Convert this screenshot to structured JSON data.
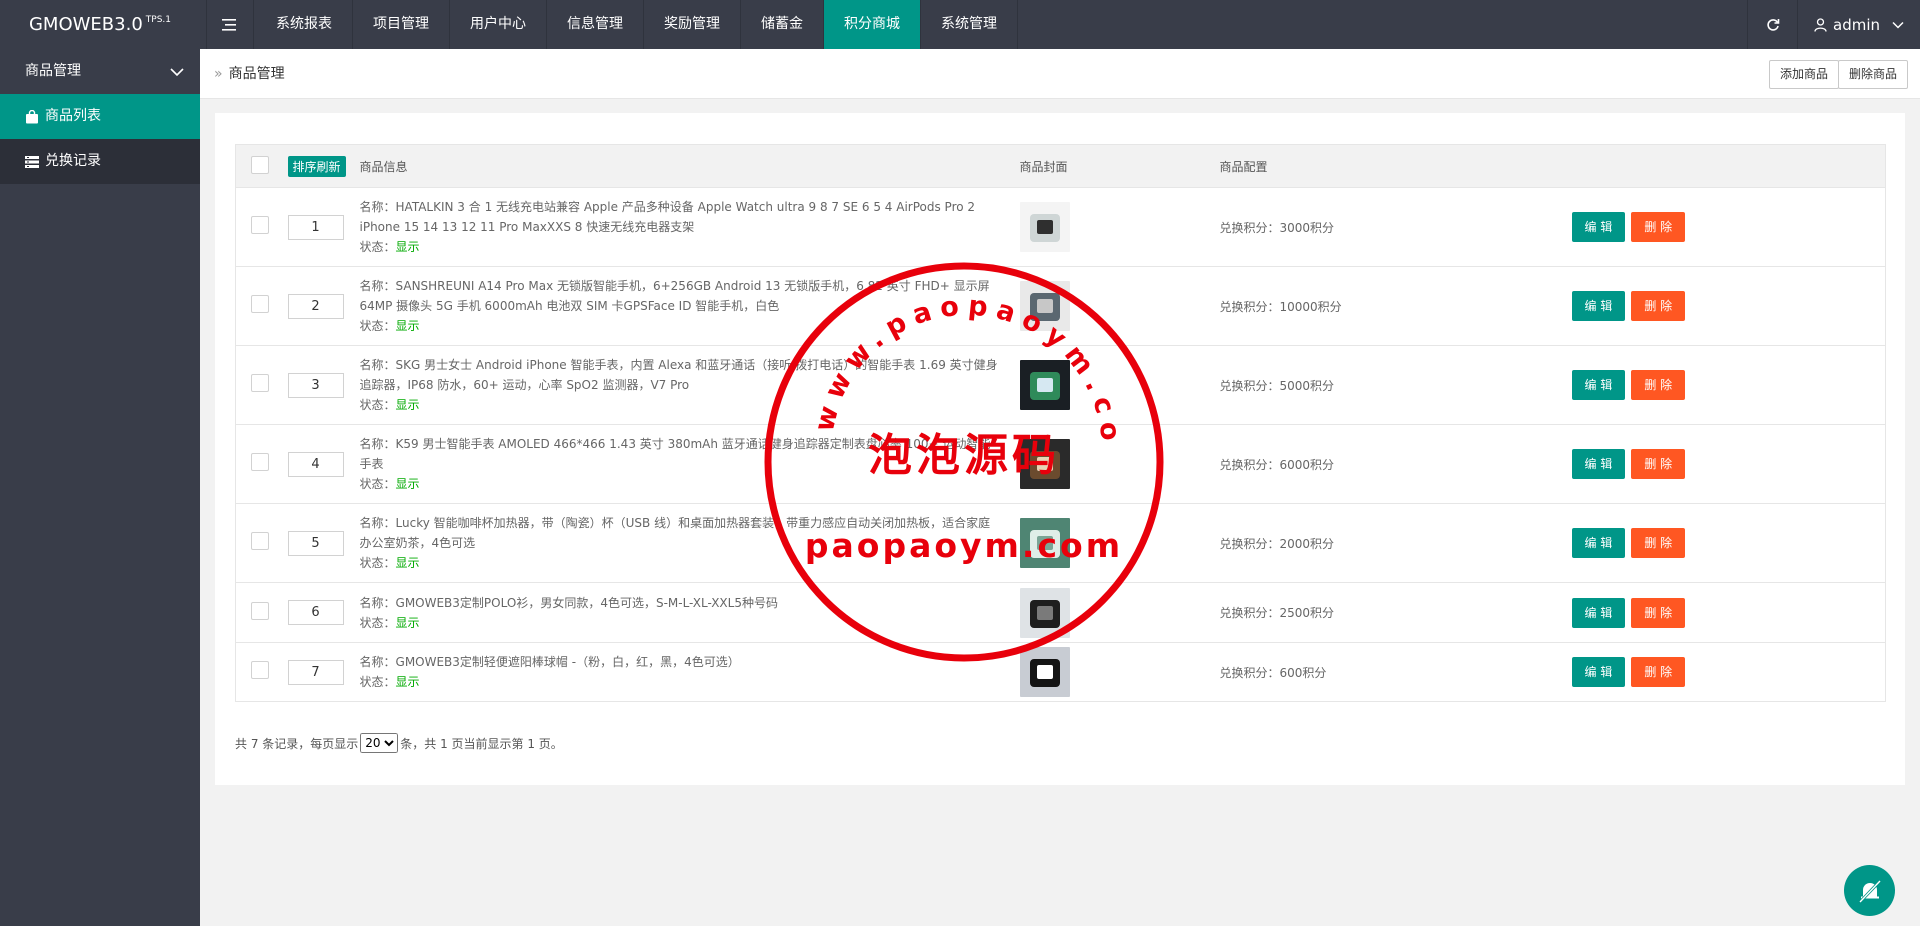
{
  "app": {
    "brand": "GMOWEB3.0",
    "brand_sup": "TPS.1"
  },
  "nav": [
    {
      "label": "系统报表",
      "active": false
    },
    {
      "label": "项目管理",
      "active": false
    },
    {
      "label": "用户中心",
      "active": false
    },
    {
      "label": "信息管理",
      "active": false
    },
    {
      "label": "奖励管理",
      "active": false
    },
    {
      "label": "储蓄金",
      "active": false
    },
    {
      "label": "积分商城",
      "active": true
    },
    {
      "label": "系统管理",
      "active": false
    }
  ],
  "user": {
    "name": "admin"
  },
  "sidebar": {
    "group": "商品管理",
    "items": [
      {
        "label": "商品列表",
        "active": true
      },
      {
        "label": "兑换记录",
        "active": false
      }
    ]
  },
  "breadcrumb": "商品管理",
  "toolbar": {
    "add": "添加商品",
    "delete": "删除商品"
  },
  "table": {
    "headers": {
      "sort": "排序刷新",
      "info": "商品信息",
      "cover": "商品封面",
      "config": "商品配置"
    },
    "name_prefix": "名称：",
    "status_prefix": "状态：",
    "edit_label": "编 辑",
    "delete_label": "删 除",
    "rows": [
      {
        "order": "1",
        "name": "HATALKIN 3 合 1 无线充电站兼容 Apple 产品多种设备 Apple Watch ultra 9 8 7 SE 6 5 4 AirPods Pro 2 iPhone 15 14 13 12 11 Pro MaxXXS 8 快速无线充电器支架",
        "status": "显示",
        "config": "兑换积分：3000积分"
      },
      {
        "order": "2",
        "name": "SANSHREUNI A14 Pro Max 无锁版智能手机，6+256GB Android 13 无锁版手机，6.82 英寸 FHD+ 显示屏 64MP 摄像头 5G 手机 6000mAh 电池双 SIM 卡GPSFace ID 智能手机，白色",
        "status": "显示",
        "config": "兑换积分：10000积分"
      },
      {
        "order": "3",
        "name": "SKG 男士女士 Android iPhone 智能手表，内置 Alexa 和蓝牙通话（接听/拨打电话）的智能手表 1.69 英寸健身追踪器，IP68 防水，60+ 运动，心率 SpO2 监测器，V7 Pro",
        "status": "显示",
        "config": "兑换积分：5000积分"
      },
      {
        "order": "4",
        "name": "K59 男士智能手表 AMOLED 466*466 1.43 英寸 380mAh 蓝牙通话健身追踪器定制表盘心率 100+ 运动智能手表",
        "status": "显示",
        "config": "兑换积分：6000积分"
      },
      {
        "order": "5",
        "name": "Lucky 智能咖啡杯加热器，带（陶瓷）杯（USB 线）和桌面加热器套装，带重力感应自动关闭加热板，适合家庭办公室奶茶，4色可选",
        "status": "显示",
        "config": "兑换积分：2000积分"
      },
      {
        "order": "6",
        "name": "GMOWEB3定制POLO衫，男女同款，4色可选，S-M-L-XL-XXL5种号码",
        "status": "显示",
        "config": "兑换积分：2500积分"
      },
      {
        "order": "7",
        "name": "GMOWEB3定制轻便遮阳棒球帽 -（粉，白，红，黑，4色可选）",
        "status": "显示",
        "config": "兑换积分：600积分"
      }
    ]
  },
  "pager": {
    "prefix": "共 7 条记录，每页显示",
    "page_size": "20",
    "suffix": "条，共 1 页当前显示第 1 页。"
  },
  "watermark": {
    "arc_text": "www.paopaoym.com",
    "center_text": "泡泡源码",
    "bottom_text": "paopaoym.com"
  },
  "colors": {
    "topbar": "#393d49",
    "accent": "#009688",
    "danger": "#ff5722",
    "stamp": "#e8000b"
  }
}
